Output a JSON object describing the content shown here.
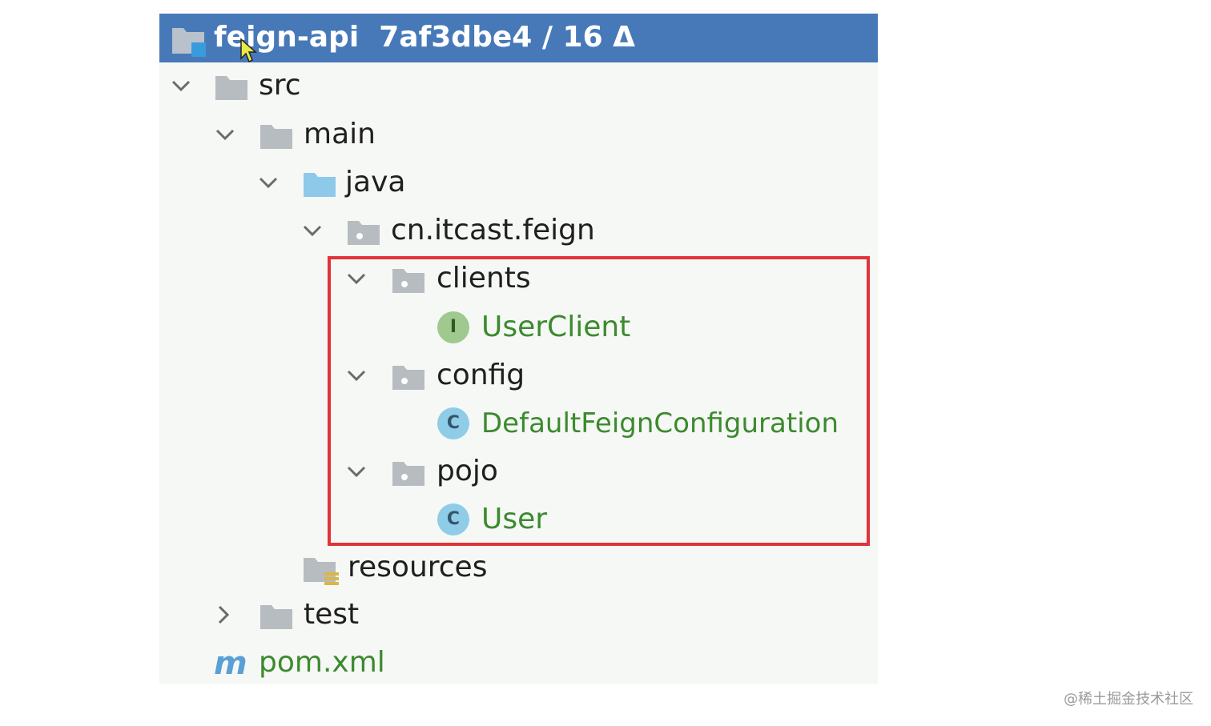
{
  "header": {
    "project": "feign-api",
    "vcs": "7af3dbe4 / 16 Δ"
  },
  "tree": {
    "src": "src",
    "main": "main",
    "java": "java",
    "package": "cn.itcast.feign",
    "clients": "clients",
    "user_client": "UserClient",
    "config": "config",
    "default_config": "DefaultFeignConfiguration",
    "pojo": "pojo",
    "user": "User",
    "resources": "resources",
    "test": "test",
    "pom": "pom.xml"
  },
  "badges": {
    "interface": "I",
    "class": "C"
  },
  "watermark": "@稀土掘金技术社区",
  "colors": {
    "header_bg": "#4779b9",
    "panel_bg": "#f6f8f5",
    "highlight_border": "#e0343a",
    "java_file_text": "#3c8a2e"
  }
}
